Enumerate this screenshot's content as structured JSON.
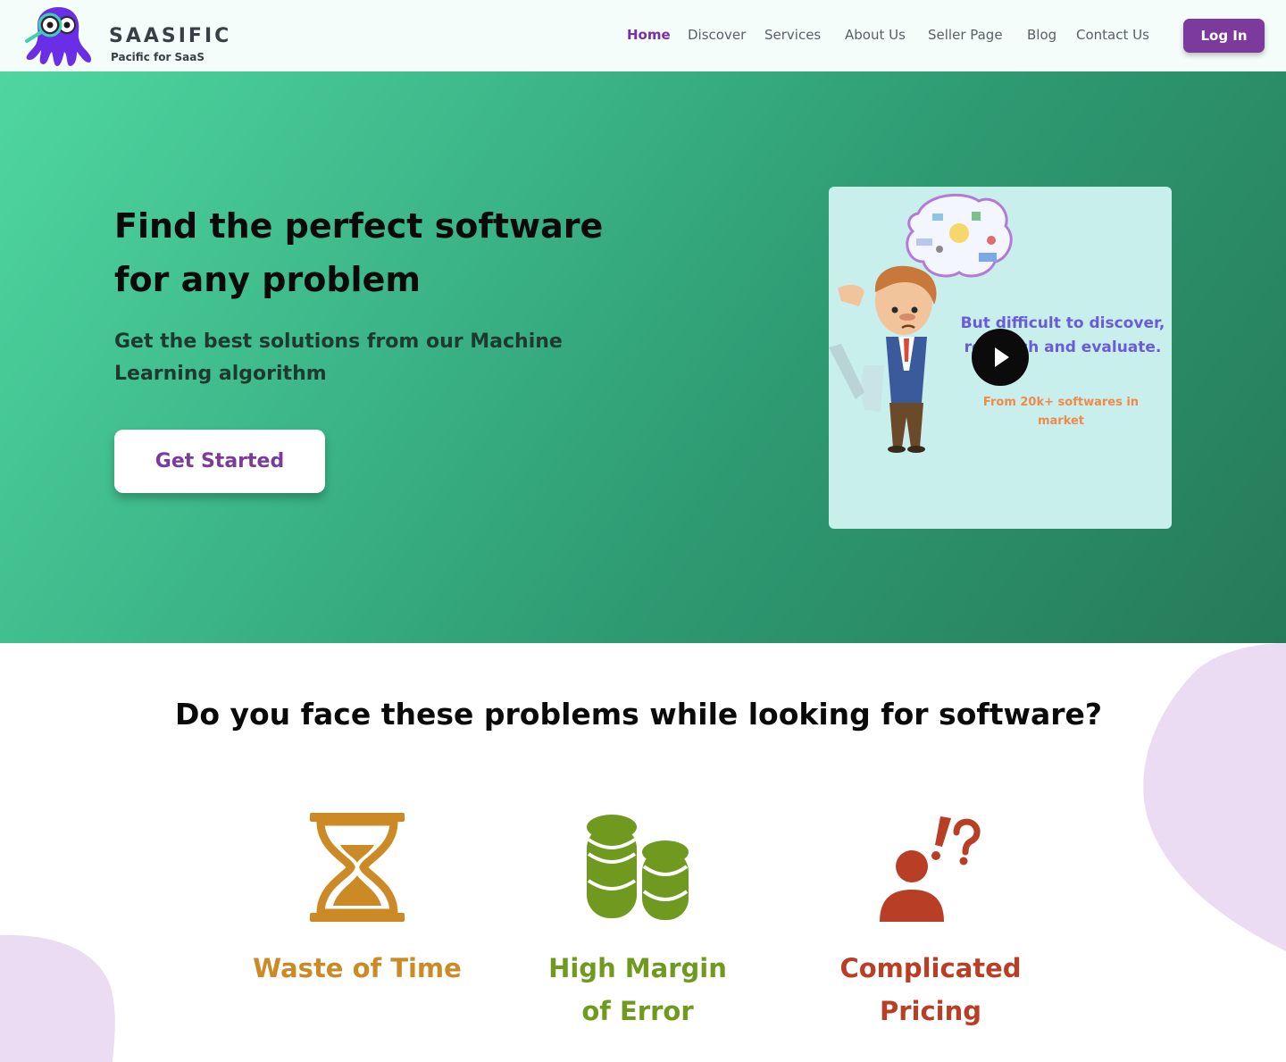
{
  "brand": {
    "name": "SAASIFIC",
    "tagline": "Pacific for SaaS",
    "logo_icon": "octopus-magnifier-icon"
  },
  "nav": {
    "items": [
      {
        "label": "Home",
        "active": true
      },
      {
        "label": "Discover",
        "active": false
      },
      {
        "label": "Services",
        "active": false
      },
      {
        "label": "About Us",
        "active": false
      },
      {
        "label": "Seller Page",
        "active": false
      },
      {
        "label": "Blog",
        "active": false
      },
      {
        "label": "Contact Us",
        "active": false
      }
    ],
    "login_label": "Log In"
  },
  "hero": {
    "title": "Find the perfect software for any problem",
    "subtitle": "Get the best solutions from our Machine Learning algorithm",
    "cta_label": "Get Started",
    "video": {
      "line1": "But difficult to discover, research and evaluate.",
      "line2": "From 20k+ softwares in market",
      "play_icon": "play-icon"
    }
  },
  "problems": {
    "title": "Do you face these problems while looking for software?",
    "items": [
      {
        "label": "Waste of Time",
        "icon": "hourglass-icon",
        "color": "#cc8a27"
      },
      {
        "label": "High Margin of Error",
        "icon": "coins-stack-icon",
        "color": "#6f9a1f"
      },
      {
        "label": "Complicated Pricing",
        "icon": "confused-person-icon",
        "color": "#b83e26"
      }
    ]
  },
  "colors": {
    "accent": "#7b3a9c",
    "hero_gradient_start": "#4fd6a0",
    "hero_gradient_end": "#267a59",
    "blob": "#ebdcf3"
  }
}
